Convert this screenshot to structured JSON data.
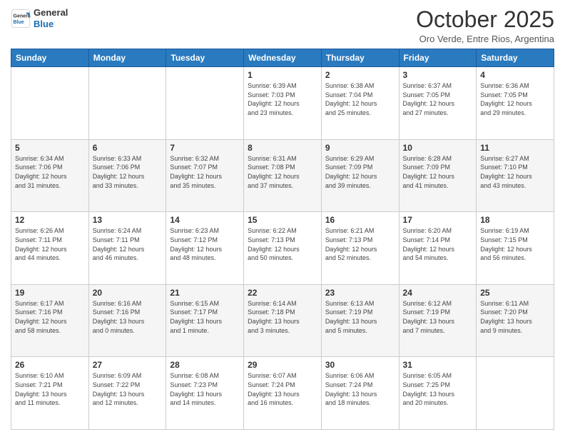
{
  "logo": {
    "line1": "General",
    "line2": "Blue"
  },
  "header": {
    "month": "October 2025",
    "location": "Oro Verde, Entre Rios, Argentina"
  },
  "weekdays": [
    "Sunday",
    "Monday",
    "Tuesday",
    "Wednesday",
    "Thursday",
    "Friday",
    "Saturday"
  ],
  "weeks": [
    [
      {
        "day": "",
        "info": ""
      },
      {
        "day": "",
        "info": ""
      },
      {
        "day": "",
        "info": ""
      },
      {
        "day": "1",
        "info": "Sunrise: 6:39 AM\nSunset: 7:03 PM\nDaylight: 12 hours\nand 23 minutes."
      },
      {
        "day": "2",
        "info": "Sunrise: 6:38 AM\nSunset: 7:04 PM\nDaylight: 12 hours\nand 25 minutes."
      },
      {
        "day": "3",
        "info": "Sunrise: 6:37 AM\nSunset: 7:05 PM\nDaylight: 12 hours\nand 27 minutes."
      },
      {
        "day": "4",
        "info": "Sunrise: 6:36 AM\nSunset: 7:05 PM\nDaylight: 12 hours\nand 29 minutes."
      }
    ],
    [
      {
        "day": "5",
        "info": "Sunrise: 6:34 AM\nSunset: 7:06 PM\nDaylight: 12 hours\nand 31 minutes."
      },
      {
        "day": "6",
        "info": "Sunrise: 6:33 AM\nSunset: 7:06 PM\nDaylight: 12 hours\nand 33 minutes."
      },
      {
        "day": "7",
        "info": "Sunrise: 6:32 AM\nSunset: 7:07 PM\nDaylight: 12 hours\nand 35 minutes."
      },
      {
        "day": "8",
        "info": "Sunrise: 6:31 AM\nSunset: 7:08 PM\nDaylight: 12 hours\nand 37 minutes."
      },
      {
        "day": "9",
        "info": "Sunrise: 6:29 AM\nSunset: 7:09 PM\nDaylight: 12 hours\nand 39 minutes."
      },
      {
        "day": "10",
        "info": "Sunrise: 6:28 AM\nSunset: 7:09 PM\nDaylight: 12 hours\nand 41 minutes."
      },
      {
        "day": "11",
        "info": "Sunrise: 6:27 AM\nSunset: 7:10 PM\nDaylight: 12 hours\nand 43 minutes."
      }
    ],
    [
      {
        "day": "12",
        "info": "Sunrise: 6:26 AM\nSunset: 7:11 PM\nDaylight: 12 hours\nand 44 minutes."
      },
      {
        "day": "13",
        "info": "Sunrise: 6:24 AM\nSunset: 7:11 PM\nDaylight: 12 hours\nand 46 minutes."
      },
      {
        "day": "14",
        "info": "Sunrise: 6:23 AM\nSunset: 7:12 PM\nDaylight: 12 hours\nand 48 minutes."
      },
      {
        "day": "15",
        "info": "Sunrise: 6:22 AM\nSunset: 7:13 PM\nDaylight: 12 hours\nand 50 minutes."
      },
      {
        "day": "16",
        "info": "Sunrise: 6:21 AM\nSunset: 7:13 PM\nDaylight: 12 hours\nand 52 minutes."
      },
      {
        "day": "17",
        "info": "Sunrise: 6:20 AM\nSunset: 7:14 PM\nDaylight: 12 hours\nand 54 minutes."
      },
      {
        "day": "18",
        "info": "Sunrise: 6:19 AM\nSunset: 7:15 PM\nDaylight: 12 hours\nand 56 minutes."
      }
    ],
    [
      {
        "day": "19",
        "info": "Sunrise: 6:17 AM\nSunset: 7:16 PM\nDaylight: 12 hours\nand 58 minutes."
      },
      {
        "day": "20",
        "info": "Sunrise: 6:16 AM\nSunset: 7:16 PM\nDaylight: 13 hours\nand 0 minutes."
      },
      {
        "day": "21",
        "info": "Sunrise: 6:15 AM\nSunset: 7:17 PM\nDaylight: 13 hours\nand 1 minute."
      },
      {
        "day": "22",
        "info": "Sunrise: 6:14 AM\nSunset: 7:18 PM\nDaylight: 13 hours\nand 3 minutes."
      },
      {
        "day": "23",
        "info": "Sunrise: 6:13 AM\nSunset: 7:19 PM\nDaylight: 13 hours\nand 5 minutes."
      },
      {
        "day": "24",
        "info": "Sunrise: 6:12 AM\nSunset: 7:19 PM\nDaylight: 13 hours\nand 7 minutes."
      },
      {
        "day": "25",
        "info": "Sunrise: 6:11 AM\nSunset: 7:20 PM\nDaylight: 13 hours\nand 9 minutes."
      }
    ],
    [
      {
        "day": "26",
        "info": "Sunrise: 6:10 AM\nSunset: 7:21 PM\nDaylight: 13 hours\nand 11 minutes."
      },
      {
        "day": "27",
        "info": "Sunrise: 6:09 AM\nSunset: 7:22 PM\nDaylight: 13 hours\nand 12 minutes."
      },
      {
        "day": "28",
        "info": "Sunrise: 6:08 AM\nSunset: 7:23 PM\nDaylight: 13 hours\nand 14 minutes."
      },
      {
        "day": "29",
        "info": "Sunrise: 6:07 AM\nSunset: 7:24 PM\nDaylight: 13 hours\nand 16 minutes."
      },
      {
        "day": "30",
        "info": "Sunrise: 6:06 AM\nSunset: 7:24 PM\nDaylight: 13 hours\nand 18 minutes."
      },
      {
        "day": "31",
        "info": "Sunrise: 6:05 AM\nSunset: 7:25 PM\nDaylight: 13 hours\nand 20 minutes."
      },
      {
        "day": "",
        "info": ""
      }
    ]
  ]
}
